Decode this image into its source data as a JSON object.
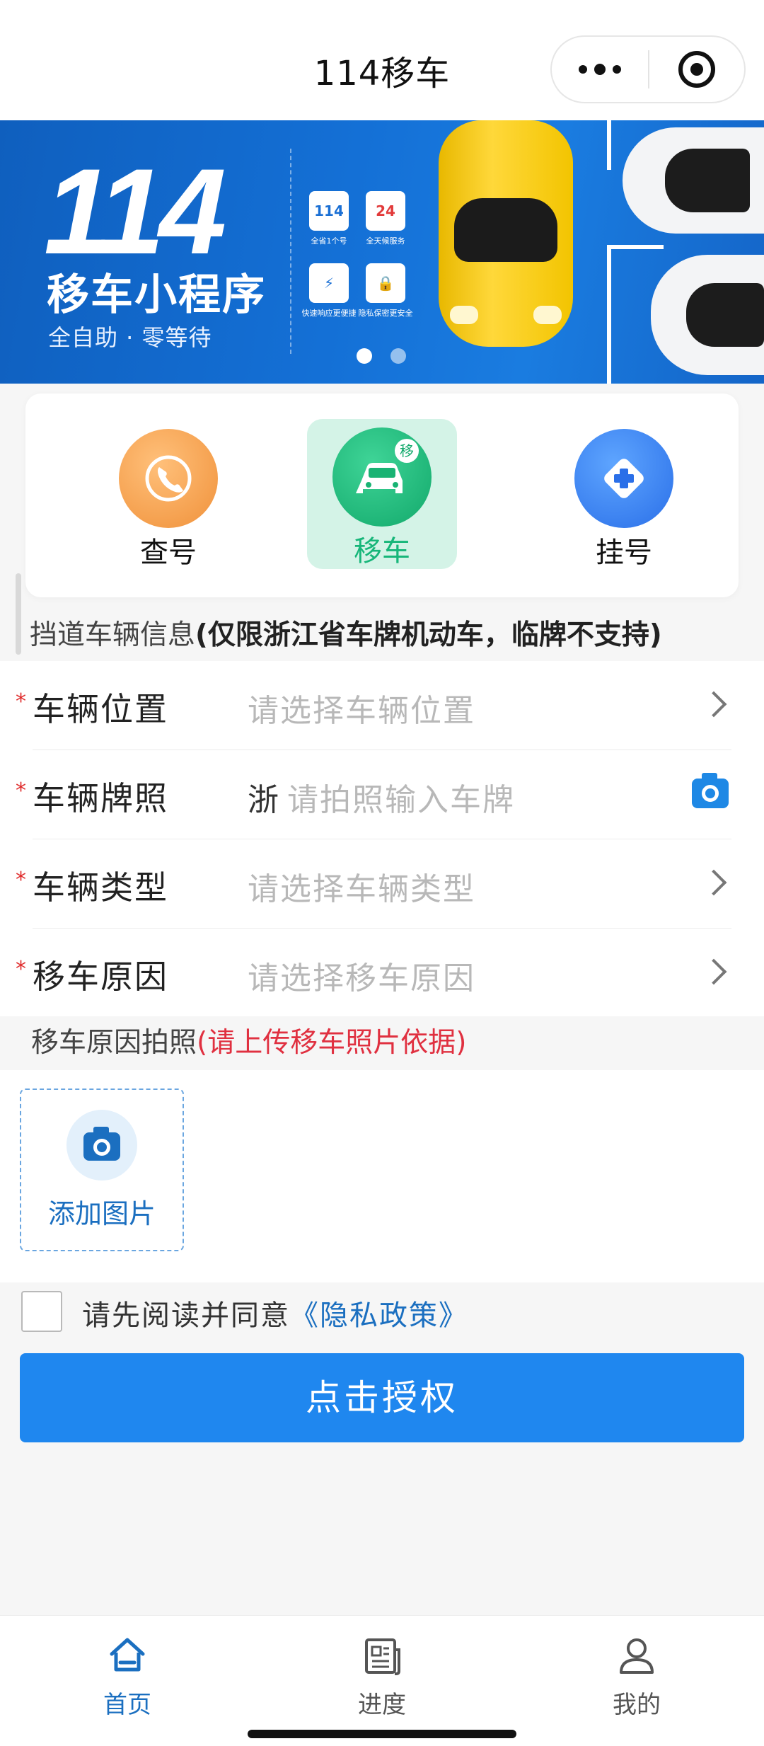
{
  "nav": {
    "title": "114移车"
  },
  "banner": {
    "big": "114",
    "subtitle": "移车小程序",
    "tagline": "全自助 · 零等待",
    "features": [
      {
        "badge": "114",
        "caption": "全省1个号"
      },
      {
        "badge": "24",
        "caption": "全天候服务"
      },
      {
        "badge": "⚡",
        "caption": "快速响应更便捷"
      },
      {
        "badge": "🔒",
        "caption": "隐私保密更安全"
      }
    ]
  },
  "services": [
    {
      "label": "查号",
      "color": "#f39a3a"
    },
    {
      "label": "移车",
      "color": "#1cb97a",
      "badge": "移"
    },
    {
      "label": "挂号",
      "color": "#2f7ff0"
    }
  ],
  "section": {
    "title": "挡道车辆信息",
    "note": "(仅限浙江省车牌机动车，临牌不支持)"
  },
  "form": {
    "location": {
      "label": "车辆位置",
      "placeholder": "请选择车辆位置"
    },
    "plate": {
      "label": "车辆牌照",
      "prefix": "浙",
      "placeholder": "请拍照输入车牌"
    },
    "type": {
      "label": "车辆类型",
      "placeholder": "请选择车辆类型"
    },
    "reason": {
      "label": "移车原因",
      "placeholder": "请选择移车原因"
    }
  },
  "photo": {
    "title": "移车原因拍照",
    "note": "(请上传移车照片依据)",
    "add_label": "添加图片"
  },
  "agree": {
    "text": "请先阅读并同意",
    "link": "《隐私政策》"
  },
  "auth_button": "点击授权",
  "tabs": [
    {
      "label": "首页",
      "icon": "home-icon"
    },
    {
      "label": "进度",
      "icon": "progress-icon"
    },
    {
      "label": "我的",
      "icon": "user-icon"
    }
  ],
  "colors": {
    "primary": "#1f87ef",
    "accent_green": "#16b679",
    "required": "#e02d2d",
    "link": "#1b6fc0"
  }
}
